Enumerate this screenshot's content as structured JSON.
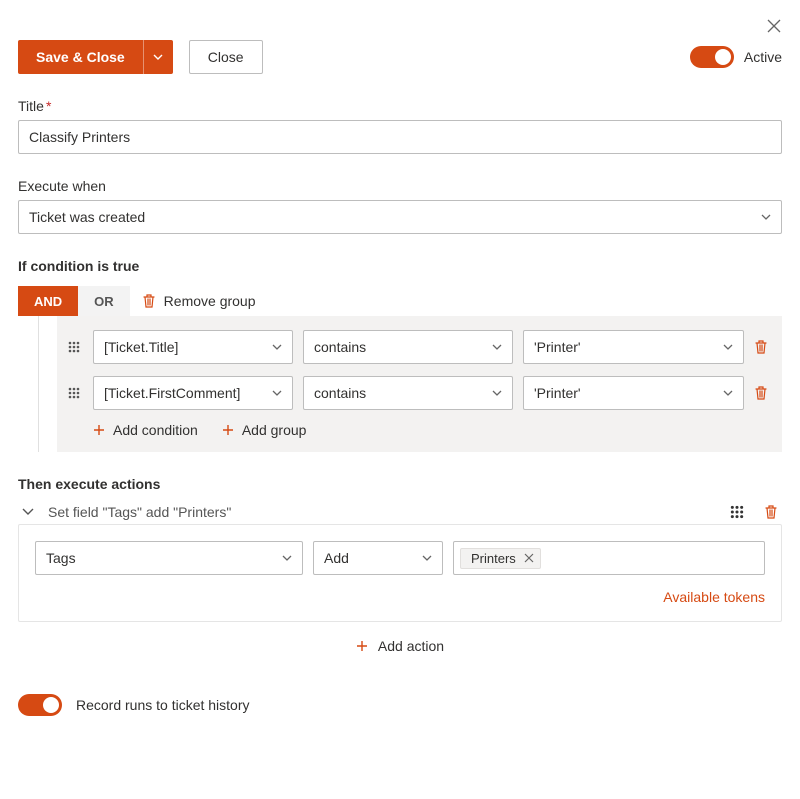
{
  "header": {
    "save_close_label": "Save & Close",
    "close_label": "Close",
    "active_label": "Active"
  },
  "title": {
    "label": "Title",
    "value": "Classify Printers"
  },
  "execute_when": {
    "label": "Execute when",
    "value": "Ticket was created"
  },
  "condition": {
    "heading": "If condition is true",
    "and_label": "AND",
    "or_label": "OR",
    "remove_group_label": "Remove group",
    "rows": [
      {
        "field": "[Ticket.Title]",
        "operator": "contains",
        "value": "'Printer'"
      },
      {
        "field": "[Ticket.FirstComment]",
        "operator": "contains",
        "value": "'Printer'"
      }
    ],
    "add_condition_label": "Add condition",
    "add_group_label": "Add group"
  },
  "actions": {
    "heading": "Then execute actions",
    "summary": "Set field \"Tags\" add \"Printers\"",
    "field_value": "Tags",
    "operation_value": "Add",
    "tag_value": "Printers",
    "available_tokens_label": "Available tokens",
    "add_action_label": "Add action"
  },
  "record": {
    "label": "Record runs to ticket history"
  }
}
